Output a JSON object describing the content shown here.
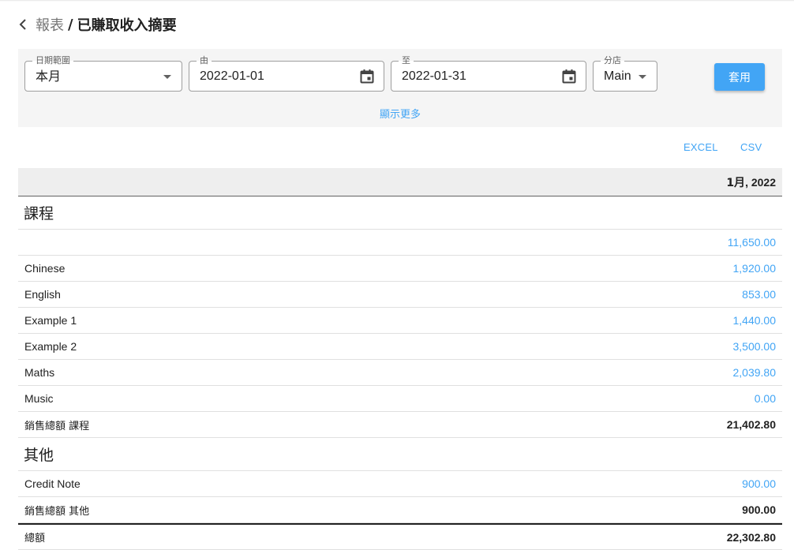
{
  "breadcrumb": {
    "parent": "報表",
    "separator": "/",
    "current": "已賺取收入摘要"
  },
  "filters": {
    "date_range": {
      "label": "日期範圍",
      "value": "本月"
    },
    "from": {
      "label": "由",
      "value": "2022-01-01"
    },
    "to": {
      "label": "至",
      "value": "2022-01-31"
    },
    "branch": {
      "label": "分店",
      "value": "Main"
    },
    "apply_label": "套用",
    "show_more_label": "顯示更多"
  },
  "export": {
    "excel_label": "EXCEL",
    "csv_label": "CSV"
  },
  "table": {
    "column_header_month": "1月",
    "column_header_year": ", 2022",
    "sections": [
      {
        "title": "課程",
        "rows": [
          {
            "label": "",
            "value": "11,650.00"
          },
          {
            "label": "Chinese",
            "value": "1,920.00"
          },
          {
            "label": "English",
            "value": "853.00"
          },
          {
            "label": "Example 1",
            "value": "1,440.00"
          },
          {
            "label": "Example 2",
            "value": "3,500.00"
          },
          {
            "label": "Maths",
            "value": "2,039.80"
          },
          {
            "label": "Music",
            "value": "0.00"
          }
        ],
        "total_label": "銷售總額 課程",
        "total_value": "21,402.80"
      },
      {
        "title": "其他",
        "rows": [
          {
            "label": "Credit Note",
            "value": "900.00"
          }
        ],
        "total_label": "銷售總額 其他",
        "total_value": "900.00"
      }
    ],
    "grand_total_label": "總額",
    "grand_total_value": "22,302.80"
  },
  "colors": {
    "accent": "#42a5f5",
    "panel": "#f5f5f5",
    "header": "#eeeeee"
  },
  "icons": {
    "back": "chevron-left-icon",
    "calendar": "calendar-icon",
    "dropdown": "caret-down-icon"
  }
}
